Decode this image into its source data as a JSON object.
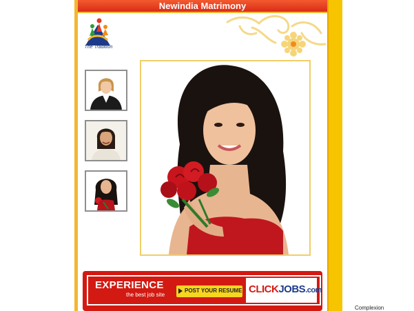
{
  "header": {
    "title": "Newindia Matrimony"
  },
  "logo": {
    "tagline": "The Tradition"
  },
  "thumbnails": [
    {
      "name": "thumbnail-businesswoman"
    },
    {
      "name": "thumbnail-woman-smiling"
    },
    {
      "name": "thumbnail-woman-roses"
    }
  ],
  "banner": {
    "headline": "EXPERIENCE",
    "subline": "the best job site",
    "button_label": "POST YOUR RESUME",
    "brand_click": "CLICK",
    "brand_jobs": "JOBS",
    "brand_com": ".com"
  },
  "side_label": "Complexion",
  "colors": {
    "header_red": "#d92c17",
    "accent_yellow": "#f7c400",
    "banner_red": "#d21a12"
  }
}
